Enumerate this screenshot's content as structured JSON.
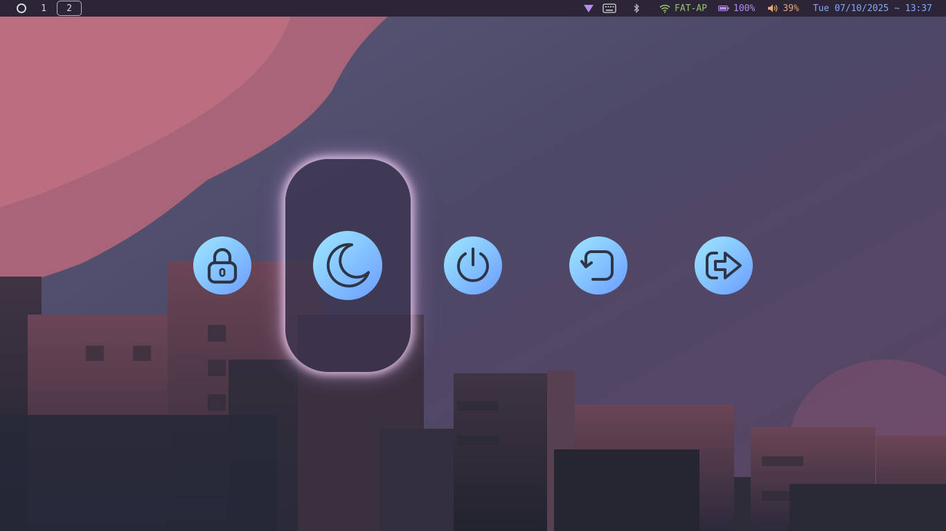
{
  "workspaces": {
    "launcher_icon": "circle-outline-icon",
    "items": [
      {
        "label": "1",
        "active": false
      },
      {
        "label": "2",
        "active": true
      }
    ]
  },
  "tray": {
    "vpn_icon": "shield-funnel-icon",
    "keyboard_icon": "keyboard-icon",
    "bluetooth_icon": "bluetooth-icon",
    "wifi": {
      "icon": "wifi-icon",
      "ssid": "FAT-AP"
    },
    "battery": {
      "icon": "battery-icon",
      "level": "100%"
    },
    "volume": {
      "icon": "speaker-icon",
      "level": "39%"
    },
    "clock": "Tue 07/10/2025 ~ 13:37"
  },
  "power_menu": {
    "buttons": [
      {
        "action": "lock",
        "icon": "lock-icon",
        "selected": false
      },
      {
        "action": "suspend",
        "icon": "moon-icon",
        "selected": true
      },
      {
        "action": "shutdown",
        "icon": "power-icon",
        "selected": false
      },
      {
        "action": "reboot",
        "icon": "reboot-icon",
        "selected": false
      },
      {
        "action": "logout",
        "icon": "logout-icon",
        "selected": false
      }
    ]
  },
  "colors": {
    "bar_background": "#2b2535",
    "accent_purple": "#b58cf5",
    "accent_green": "#98c379",
    "accent_orange": "#e5a77a",
    "accent_blue": "#82aaff",
    "button_gradient_start": "#9fe6ff",
    "button_gradient_end": "#6c9cff",
    "selection_glow": "#eecdf2"
  }
}
